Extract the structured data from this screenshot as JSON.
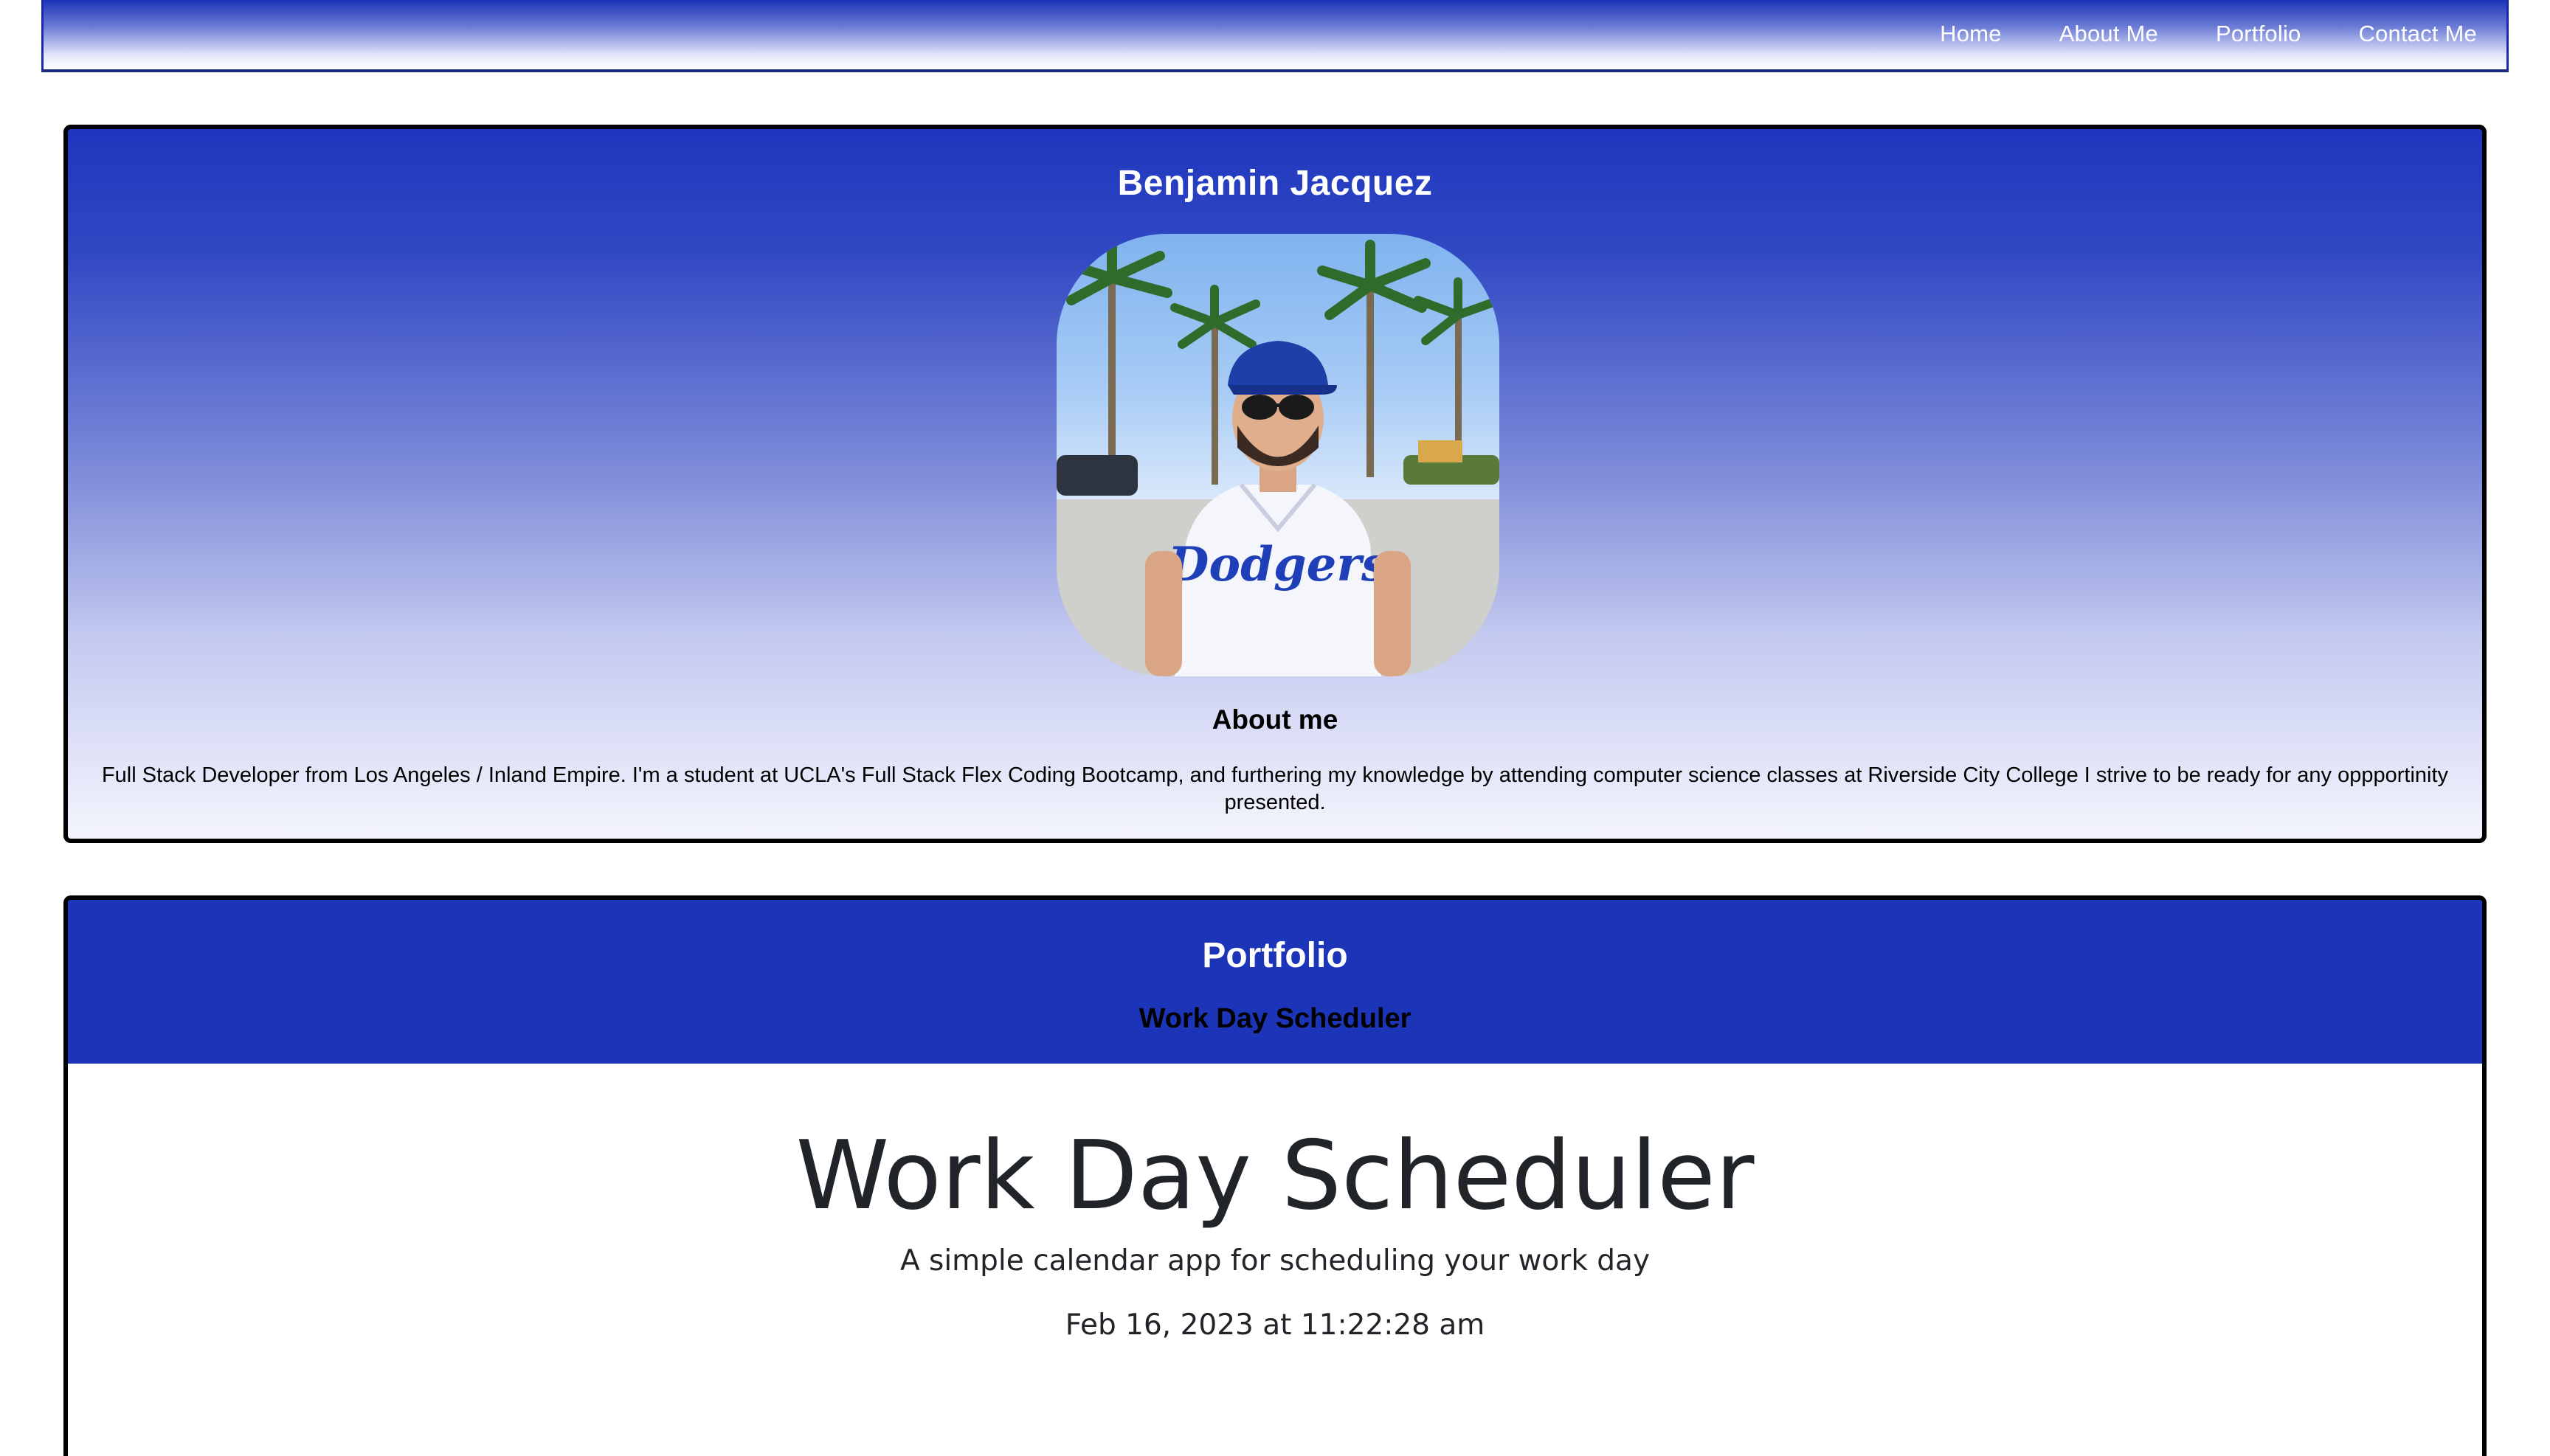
{
  "nav": {
    "items": [
      {
        "label": "Home"
      },
      {
        "label": "About Me"
      },
      {
        "label": "Portfolio"
      },
      {
        "label": "Contact Me"
      }
    ]
  },
  "about": {
    "name": "Benjamin Jacquez",
    "photo_icon": "profile-photo",
    "heading": "About me",
    "text": "Full Stack Developer from Los Angeles / Inland Empire. I'm a student at UCLA's Full Stack Flex Coding Bootcamp, and furthering my knowledge by attending computer science classes at Riverside City College I strive to be ready for any oppportinity presented."
  },
  "portfolio": {
    "title": "Portfolio",
    "project_title": "Work Day Scheduler",
    "embed": {
      "title": "Work Day Scheduler",
      "subtitle": "A simple calendar app for scheduling your work day",
      "date": "Feb 16, 2023 at 11:22:28 am"
    }
  },
  "colors": {
    "brand_blue": "#1b34b8",
    "text_dark": "#212529"
  }
}
